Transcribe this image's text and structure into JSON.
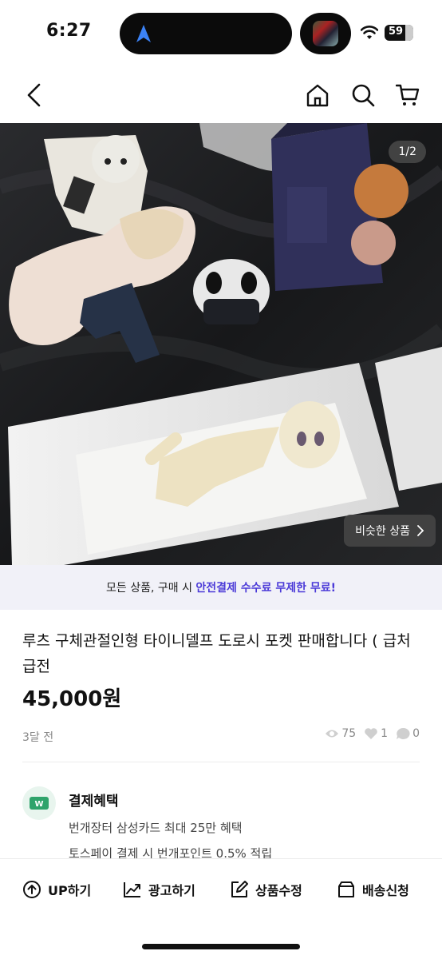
{
  "status_bar": {
    "time": "6:27",
    "battery": "59"
  },
  "header": {
    "back_icon": "chevron-left-icon",
    "home_icon": "home-icon",
    "search_icon": "search-icon",
    "cart_icon": "cart-icon"
  },
  "gallery": {
    "counter": "1/2",
    "similar_label": "비슷한 상품"
  },
  "promo": {
    "prefix": "모든 상품, 구매 시 ",
    "highlight": "안전결제 수수료 무제한 무료!"
  },
  "product": {
    "title": "루츠 구체관절인형 타이니델프 도로시 포켓 판매합니다 ( 급처 급전",
    "price": "45,000원",
    "time_ago": "3달 전",
    "views": "75",
    "likes": "1",
    "chats": "0"
  },
  "benefits": {
    "title": "결제혜택",
    "lines": [
      "번개장터 삼성카드 최대 25만 혜택",
      "토스페이 결제 시 번개포인트 0.5% 적립"
    ]
  },
  "bottom_bar": {
    "up": "UP하기",
    "ad": "광고하기",
    "edit": "상품수정",
    "delivery": "배송신청"
  },
  "colors": {
    "accent": "#4b3ad8",
    "promo_bg": "#f1f1f8"
  }
}
